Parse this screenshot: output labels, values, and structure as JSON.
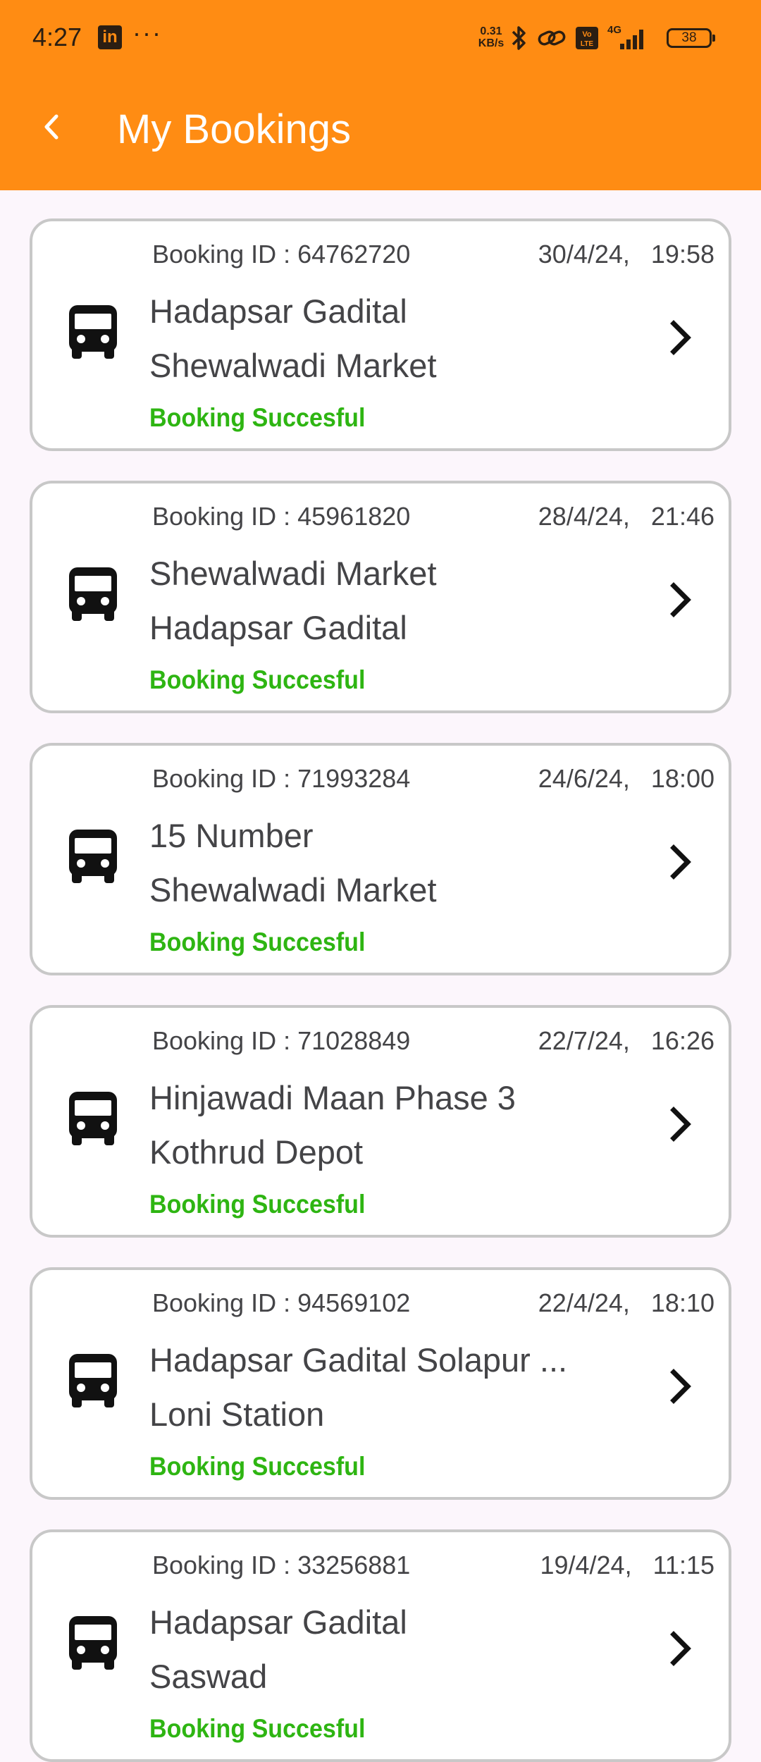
{
  "status_bar": {
    "time": "4:27",
    "linkedin_icon_text": "in",
    "more": "···",
    "net_speed": "0.31\nKB/s",
    "network": "4G",
    "battery": "38"
  },
  "header": {
    "title": "My Bookings",
    "back_icon": "back-chevron-icon"
  },
  "theme": {
    "accent": "#FF8C13",
    "success": "#2EB512",
    "background": "#FCF6FC",
    "card_border": "#C8C8C8"
  },
  "bookings": [
    {
      "id_label": "Booking ID : 64762720",
      "date": "30/4/24,   19:58",
      "from": "Hadapsar Gadital",
      "to": "Shewalwadi Market",
      "status": "Booking Succesful"
    },
    {
      "id_label": "Booking ID : 45961820",
      "date": "28/4/24,   21:46",
      "from": "Shewalwadi Market",
      "to": "Hadapsar Gadital",
      "status": "Booking Succesful"
    },
    {
      "id_label": "Booking ID : 71993284",
      "date": "24/6/24,   18:00",
      "from": "15 Number",
      "to": "Shewalwadi Market",
      "status": "Booking Succesful"
    },
    {
      "id_label": "Booking ID : 71028849",
      "date": "22/7/24,   16:26",
      "from": "Hinjawadi Maan Phase 3",
      "to": "Kothrud Depot",
      "status": "Booking Succesful"
    },
    {
      "id_label": "Booking ID : 94569102",
      "date": "22/4/24,   18:10",
      "from": "Hadapsar Gadital Solapur ...",
      "to": "Loni Station",
      "status": "Booking Succesful"
    },
    {
      "id_label": "Booking ID : 33256881",
      "date": "19/4/24,   11:15",
      "from": "Hadapsar Gadital",
      "to": "Saswad",
      "status": "Booking Succesful"
    }
  ]
}
